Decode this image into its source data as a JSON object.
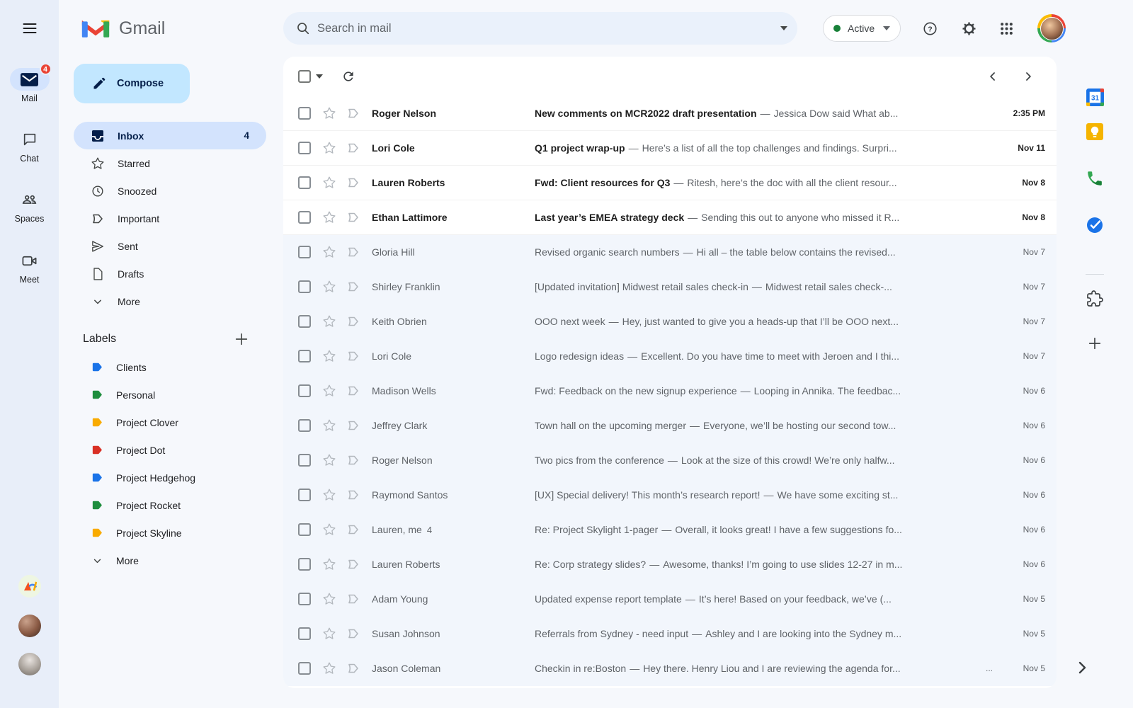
{
  "app": {
    "name": "Gmail"
  },
  "colors": {
    "compose_bg": "#c2e7ff",
    "selected_bg": "#d3e3fd",
    "badge_red": "#ea4335",
    "active_dot": "#188038",
    "read_row_bg": "#f2f6fc"
  },
  "left_rail": {
    "items": [
      {
        "label": "Mail",
        "icon": "mail-icon",
        "badge": "4",
        "active": true
      },
      {
        "label": "Chat",
        "icon": "chat-icon"
      },
      {
        "label": "Spaces",
        "icon": "spaces-icon"
      },
      {
        "label": "Meet",
        "icon": "meet-icon"
      }
    ]
  },
  "sidebar": {
    "compose_label": "Compose",
    "nav_items": [
      {
        "label": "Inbox",
        "icon": "inbox-icon",
        "count": "4",
        "active": true
      },
      {
        "label": "Starred",
        "icon": "star-icon"
      },
      {
        "label": "Snoozed",
        "icon": "clock-icon"
      },
      {
        "label": "Important",
        "icon": "important-icon"
      },
      {
        "label": "Sent",
        "icon": "send-icon"
      },
      {
        "label": "Drafts",
        "icon": "draft-icon"
      },
      {
        "label": "More",
        "icon": "chevron-down-icon"
      }
    ],
    "labels_header": "Labels",
    "labels": [
      {
        "name": "Clients",
        "color": "#1a73e8"
      },
      {
        "name": "Personal",
        "color": "#1e8e3e"
      },
      {
        "name": "Project Clover",
        "color": "#f9ab00"
      },
      {
        "name": "Project Dot",
        "color": "#d93025"
      },
      {
        "name": "Project Hedgehog",
        "color": "#1a73e8"
      },
      {
        "name": "Project Rocket",
        "color": "#1e8e3e"
      },
      {
        "name": "Project Skyline",
        "color": "#f9ab00"
      }
    ],
    "labels_more_label": "More"
  },
  "header": {
    "search_placeholder": "Search in mail",
    "status_label": "Active"
  },
  "mail_list": {
    "separator": "—",
    "rows": [
      {
        "sender": "Roger Nelson",
        "subject": "New comments on MCR2022 draft presentation",
        "snippet": "Jessica Dow said What ab...",
        "date": "2:35 PM",
        "unread": true
      },
      {
        "sender": "Lori Cole",
        "subject": "Q1 project wrap-up",
        "snippet": "Here’s a list of all the top challenges and findings. Surpri...",
        "date": "Nov 11",
        "unread": true
      },
      {
        "sender": "Lauren Roberts",
        "subject": "Fwd: Client resources for Q3",
        "snippet": "Ritesh, here’s the doc with all the client resour...",
        "date": "Nov 8",
        "unread": true
      },
      {
        "sender": "Ethan Lattimore",
        "subject": "Last year’s EMEA strategy deck",
        "snippet": "Sending this out to anyone who missed it R...",
        "date": "Nov 8",
        "unread": true
      },
      {
        "sender": "Gloria Hill",
        "subject": "Revised organic search numbers",
        "snippet": "Hi all – the table below contains the revised...",
        "date": "Nov 7",
        "unread": false
      },
      {
        "sender": "Shirley Franklin",
        "subject": "[Updated invitation] Midwest retail sales check-in",
        "snippet": "Midwest retail sales check-...",
        "date": "Nov 7",
        "unread": false
      },
      {
        "sender": "Keith Obrien",
        "subject": "OOO next week",
        "snippet": "Hey, just wanted to give you a heads-up that I’ll be OOO next...",
        "date": "Nov 7",
        "unread": false
      },
      {
        "sender": "Lori Cole",
        "subject": "Logo redesign ideas",
        "snippet": "Excellent. Do you have time to meet with Jeroen and I thi...",
        "date": "Nov 7",
        "unread": false
      },
      {
        "sender": "Madison Wells",
        "subject": "Fwd: Feedback on the new signup experience",
        "snippet": "Looping in Annika. The feedbac...",
        "date": "Nov 6",
        "unread": false
      },
      {
        "sender": "Jeffrey Clark",
        "subject": "Town hall on the upcoming merger",
        "snippet": "Everyone, we’ll be hosting our second tow...",
        "date": "Nov 6",
        "unread": false
      },
      {
        "sender": "Roger Nelson",
        "subject": "Two pics from the conference",
        "snippet": "Look at the size of this crowd! We’re only halfw...",
        "date": "Nov 6",
        "unread": false
      },
      {
        "sender": "Raymond Santos",
        "subject": "[UX] Special delivery! This month’s research report!",
        "snippet": "We have some exciting st...",
        "date": "Nov 6",
        "unread": false
      },
      {
        "sender": "Lauren, me",
        "thread_count": "4",
        "subject": "Re: Project Skylight 1-pager",
        "snippet": "Overall, it looks great! I have a few suggestions fo...",
        "date": "Nov 6",
        "unread": false
      },
      {
        "sender": "Lauren Roberts",
        "subject": "Re: Corp strategy slides?",
        "snippet": "Awesome, thanks! I’m going to use slides 12-27 in m...",
        "date": "Nov 6",
        "unread": false
      },
      {
        "sender": "Adam Young",
        "subject": "Updated expense report template",
        "snippet": "It’s here! Based on your feedback, we’ve (...",
        "date": "Nov 5",
        "unread": false
      },
      {
        "sender": "Susan Johnson",
        "subject": "Referrals from Sydney - need input",
        "snippet": "Ashley and I are looking into the Sydney m...",
        "date": "Nov 5",
        "unread": false
      },
      {
        "sender": "Jason Coleman",
        "subject": "Checkin in re:Boston",
        "snippet": "Hey there. Henry Liou and I are reviewing the agenda for...",
        "date": "Nov 5",
        "unread": false,
        "trailing_dots": "..."
      }
    ]
  },
  "right_rail": {
    "icons": [
      "calendar-icon",
      "keep-icon",
      "voice-icon",
      "tasks-icon",
      "divider",
      "add-ons-icon",
      "plus-icon"
    ]
  }
}
